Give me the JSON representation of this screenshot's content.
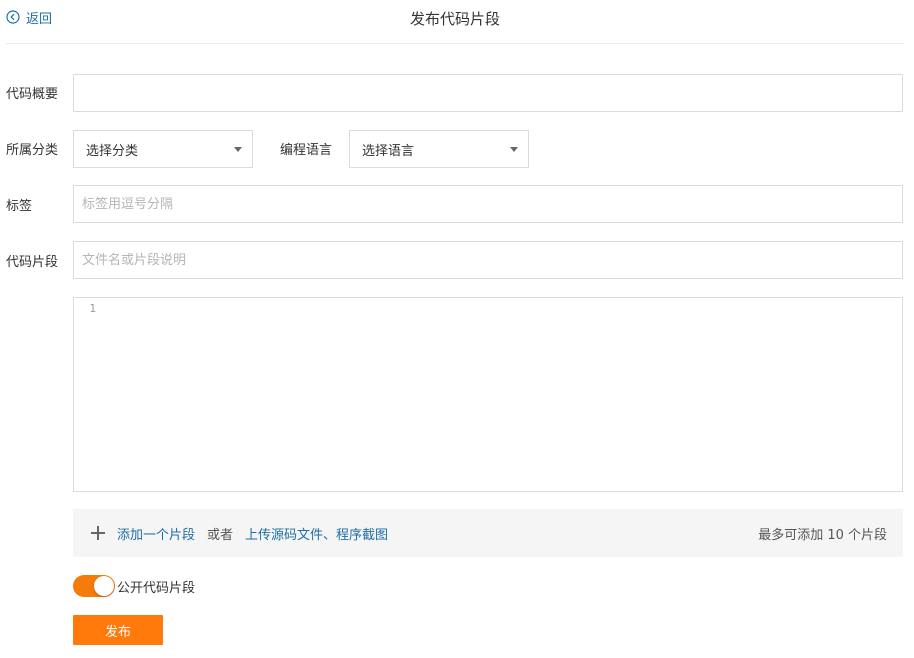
{
  "header": {
    "back_label": "返回",
    "title": "发布代码片段"
  },
  "form": {
    "summary_label": "代码概要",
    "summary_value": "",
    "category_label": "所属分类",
    "category_selected": "选择分类",
    "language_label": "编程语言",
    "language_selected": "选择语言",
    "tags_label": "标签",
    "tags_placeholder": "标签用逗号分隔",
    "snippet_label": "代码片段",
    "snippet_name_placeholder": "文件名或片段说明",
    "editor_line_numbers": [
      "1"
    ]
  },
  "add_bar": {
    "add_link": "添加一个片段",
    "or_text": "或者",
    "upload_link": "上传源码文件、程序截图",
    "limit_text": "最多可添加 10 个片段"
  },
  "public_toggle": {
    "label": "公开代码片段",
    "on": true,
    "color": "#f57b0a"
  },
  "publish_button": {
    "label": "发布",
    "color": "#ff7a0a"
  },
  "colors": {
    "link": "#1c6ea4"
  }
}
